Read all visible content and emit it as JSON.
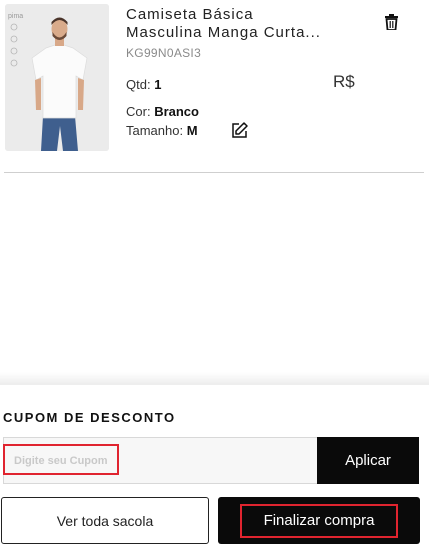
{
  "cart_item": {
    "name_line1": "Camiseta Básica",
    "name_line2": "Masculina Manga Curta...",
    "sku": "KG99N0ASI3",
    "image_brand": "pima",
    "quantity_label": "Qtd:",
    "quantity_value": "1",
    "price": "R$",
    "color_label": "Cor:",
    "color_value": "Branco",
    "size_label": "Tamanho:",
    "size_value": "M"
  },
  "coupon": {
    "title": "CUPOM DE DESCONTO",
    "placeholder": "Digite seu Cupom",
    "value": "",
    "apply_label": "Aplicar"
  },
  "actions": {
    "view_cart_label": "Ver toda sacola",
    "checkout_label": "Finalizar compra"
  },
  "colors": {
    "primary_button": "#0a0a0a",
    "highlight": "#e0242f"
  },
  "icons": {
    "delete": "trash-icon",
    "edit": "pencil-icon"
  }
}
